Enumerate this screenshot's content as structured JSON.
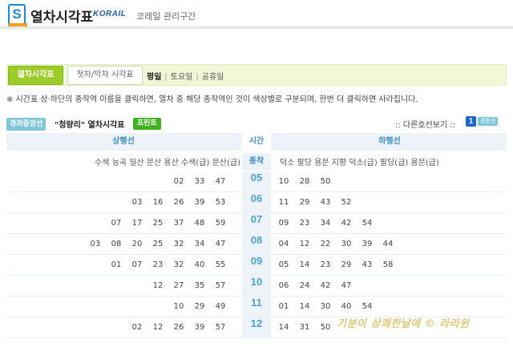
{
  "header": {
    "logo_letter": "S",
    "title": "열차시각표",
    "brand": "KORAIL",
    "brand_sub": "코레일 관리구간"
  },
  "tabs": [
    {
      "label": "열차시각표",
      "active": true
    },
    {
      "label": "첫차/막차 시각표",
      "active": false
    }
  ],
  "day_types": {
    "current": "평일",
    "others": [
      "토요일",
      "공휴일"
    ]
  },
  "notice": "※ 시간표 상·하단의 종착역 이름을 클릭하면, 열차 중 해당 종착역인 것이 색상별로 구분되며, 한번 더 클릭하면 사라집니다.",
  "line": {
    "name": "경의중앙선",
    "station_title": "\"청량리\" 열차시각표",
    "print_label": "프린트",
    "other_lines_label": ":: 다른호선보기 ::",
    "other_line_number": "1",
    "other_line_tag": "경춘선",
    "color": "#7dc7d9"
  },
  "timetable": {
    "up_label": "상행선",
    "time_label": "시간",
    "down_label": "하행선",
    "terminal_label": "종착",
    "up_destinations": "수색 능곡 일산 문산 용산 수색(급) 문산(급)",
    "down_destinations": "덕소 팔당 용문 지평 덕소(급) 팔당(급) 용문(급)",
    "rows": [
      {
        "hour": "05",
        "up": [
          "02",
          "33",
          "47"
        ],
        "down": [
          "10",
          "28",
          "50"
        ]
      },
      {
        "hour": "06",
        "up": [
          "03",
          "16",
          "26",
          "39",
          "53"
        ],
        "down": [
          "11",
          "29",
          "43",
          "52"
        ]
      },
      {
        "hour": "07",
        "up": [
          "07",
          "17",
          "25",
          "37",
          "48",
          "59"
        ],
        "down": [
          "09",
          "23",
          "34",
          "42",
          "54"
        ]
      },
      {
        "hour": "08",
        "up": [
          "03",
          "08",
          "20",
          "25",
          "32",
          "34",
          "47"
        ],
        "down": [
          "04",
          "12",
          "22",
          "30",
          "39",
          "44"
        ]
      },
      {
        "hour": "09",
        "up": [
          "01",
          "07",
          "23",
          "32",
          "40",
          "55"
        ],
        "down": [
          "05",
          "14",
          "23",
          "29",
          "43",
          "58"
        ]
      },
      {
        "hour": "10",
        "up": [
          "12",
          "27",
          "35",
          "57"
        ],
        "down": [
          "06",
          "24",
          "42",
          "47"
        ]
      },
      {
        "hour": "11",
        "up": [
          "10",
          "29",
          "49"
        ],
        "down": [
          "01",
          "14",
          "30",
          "40",
          "54"
        ]
      },
      {
        "hour": "12",
        "up": [
          "02",
          "12",
          "26",
          "39",
          "57"
        ],
        "down": [
          "14",
          "31",
          "50"
        ]
      }
    ]
  },
  "watermark": "기분이 상쾌한날에 © 라라윈"
}
